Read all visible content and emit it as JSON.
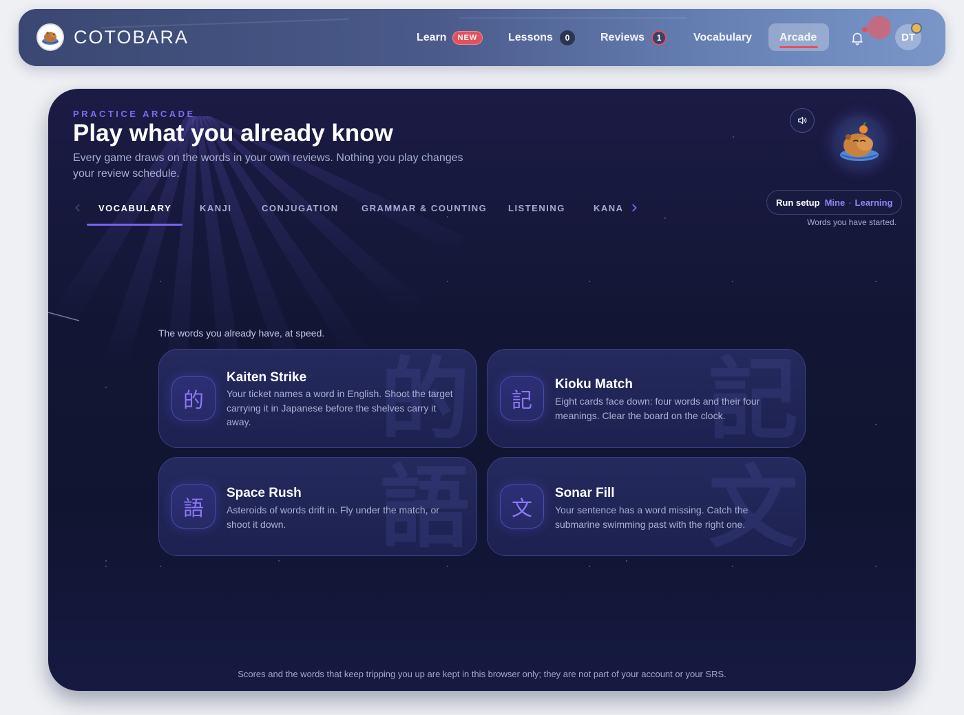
{
  "brand": {
    "name": "COTOBARA",
    "logo_icon": "capybara-logo-icon"
  },
  "nav": {
    "learn": {
      "label": "Learn",
      "badge": "NEW"
    },
    "lessons": {
      "label": "Lessons",
      "count": "0"
    },
    "reviews": {
      "label": "Reviews",
      "count": "1"
    },
    "vocabulary": {
      "label": "Vocabulary"
    },
    "arcade": {
      "label": "Arcade",
      "active": true
    },
    "notifications_icon": "bell-icon",
    "avatar_initials": "DT"
  },
  "hero": {
    "eyebrow": "PRACTICE ARCADE",
    "title": "Play what you already know",
    "subtitle": "Every game draws on the words in your own reviews. Nothing you play changes your review schedule.",
    "sound_icon": "speaker-icon"
  },
  "tabs": [
    {
      "label": "VOCABULARY",
      "active": true
    },
    {
      "label": "KANJI"
    },
    {
      "label": "CONJUGATION"
    },
    {
      "label": "GRAMMAR & COUNTING"
    },
    {
      "label": "LISTENING"
    },
    {
      "label": "KANA"
    }
  ],
  "run_setup": {
    "label": "Run setup",
    "value_1": "Mine",
    "separator": "·",
    "value_2": "Learning",
    "note": "Words you have started."
  },
  "section": {
    "lede": "The words you already have, at speed."
  },
  "games": [
    {
      "glyph": "的",
      "title": "Kaiten Strike",
      "description": "Your ticket names a word in English. Shoot the target carrying it in Japanese before the shelves carry it away."
    },
    {
      "glyph": "記",
      "title": "Kioku Match",
      "description": "Eight cards face down: four words and their four meanings. Clear the board on the clock."
    },
    {
      "glyph": "語",
      "title": "Space Rush",
      "description": "Asteroids of words drift in. Fly under the match, or shoot it down."
    },
    {
      "glyph": "文",
      "title": "Sonar Fill",
      "description": "Your sentence has a word missing. Catch the submarine swimming past with the right one."
    }
  ],
  "footnote": "Scores and the words that keep tripping you up are kept in this browser only; they are not part of your account or your SRS.",
  "colors": {
    "accent": "#7a62ef",
    "badge_red": "#e2525d",
    "panel_bg": "#121634"
  }
}
